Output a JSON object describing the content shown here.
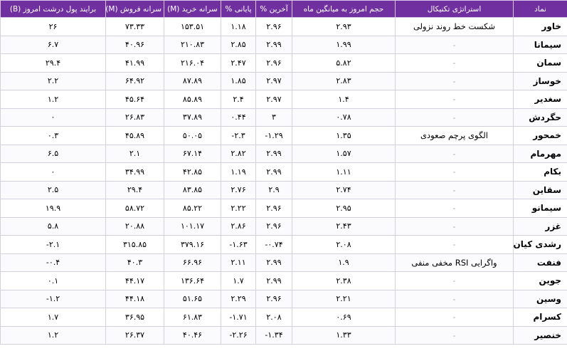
{
  "headers": {
    "symbol": "نماد",
    "strategy": "استراتژی تکنیکال",
    "volume_ratio": "حجم امروز به میانگین ماه",
    "last_pct": "آخرین %",
    "close_pct": "پایانی %",
    "buy_per_capita": "سرانه خرید (M)",
    "sell_per_capita": "سرانه فروش (M)",
    "money_flow": "برایند پول درشت امروز (B)"
  },
  "rows": [
    {
      "symbol": "خاور",
      "strategy": "شکست خط روند نزولی",
      "volume_ratio": "۲.۹۳",
      "last_pct": "۲.۹۶",
      "close_pct": "۱.۱۸",
      "buy_per_capita": "۱۵۳.۵۱",
      "sell_per_capita": "۷۳.۳۳",
      "money_flow": "۲۶"
    },
    {
      "symbol": "سیمانا",
      "strategy": "-",
      "volume_ratio": "۱.۹۹",
      "last_pct": "۲.۹۹",
      "close_pct": "۲.۸۵",
      "buy_per_capita": "۲۱۰.۸۳",
      "sell_per_capita": "۴۰.۹۶",
      "money_flow": "۶.۷"
    },
    {
      "symbol": "سمان",
      "strategy": "-",
      "volume_ratio": "۵.۸۲",
      "last_pct": "۲.۹۶",
      "close_pct": "۲.۴۷",
      "buy_per_capita": "۲۱۶.۰۴",
      "sell_per_capita": "۴۱.۹۹",
      "money_flow": "۲۹.۴"
    },
    {
      "symbol": "خوساز",
      "strategy": "-",
      "volume_ratio": "۲.۸۳",
      "last_pct": "۲.۹۷",
      "close_pct": "۱.۸۵",
      "buy_per_capita": "۸۷.۸۹",
      "sell_per_capita": "۶۴.۹۲",
      "money_flow": "۲.۲"
    },
    {
      "symbol": "سغدیر",
      "strategy": "-",
      "volume_ratio": "۱.۴",
      "last_pct": "۲.۹۷",
      "close_pct": "۲.۴",
      "buy_per_capita": "۸۵.۸۹",
      "sell_per_capita": "۴۵.۶۴",
      "money_flow": "۱.۲"
    },
    {
      "symbol": "حگردش",
      "strategy": "-",
      "volume_ratio": "۰.۷۸",
      "last_pct": "۳",
      "close_pct": "۰.۴۴",
      "buy_per_capita": "۳۷.۸۹",
      "sell_per_capita": "۲۶.۸۳",
      "money_flow": "۰"
    },
    {
      "symbol": "خمحور",
      "strategy": "الگوی پرچم صعودی",
      "volume_ratio": "۱.۳۵",
      "last_pct": "۱.۲۹-",
      "close_pct": "۲.۳-",
      "buy_per_capita": "۵۰.۰۵",
      "sell_per_capita": "۴۵.۸۹",
      "money_flow": "۰.۳"
    },
    {
      "symbol": "مهرمام",
      "strategy": "-",
      "volume_ratio": "۱.۵۷",
      "last_pct": "۲.۹۹",
      "close_pct": "۲.۸۲",
      "buy_per_capita": "۶۷.۱۴",
      "sell_per_capita": "۲.۱",
      "money_flow": "۶.۵"
    },
    {
      "symbol": "بکام",
      "strategy": "-",
      "volume_ratio": "۱.۱۱",
      "last_pct": "۲.۹۹",
      "close_pct": "۱.۱۹",
      "buy_per_capita": "۴۲.۸۵",
      "sell_per_capita": "۳۴.۹۹",
      "money_flow": "۰"
    },
    {
      "symbol": "سقاین",
      "strategy": "-",
      "volume_ratio": "۲.۷۴",
      "last_pct": "۲.۹",
      "close_pct": "۲.۷۶",
      "buy_per_capita": "۸۳.۸۵",
      "sell_per_capita": "۲۹.۴",
      "money_flow": "۲.۵"
    },
    {
      "symbol": "سیمانو",
      "strategy": "-",
      "volume_ratio": "۲.۹۵",
      "last_pct": "۲.۹۶",
      "close_pct": "۲.۲۲",
      "buy_per_capita": "۸۵.۲۲",
      "sell_per_capita": "۵۸.۷۲",
      "money_flow": "۱۹.۹"
    },
    {
      "symbol": "غزر",
      "strategy": "-",
      "volume_ratio": "۲.۴۳",
      "last_pct": "۲.۹۶",
      "close_pct": "۲.۸۶",
      "buy_per_capita": "۱۰۱.۱۷",
      "sell_per_capita": "۲۰.۸۸",
      "money_flow": "۵.۸"
    },
    {
      "symbol": "رشدی کیان",
      "strategy": "-",
      "volume_ratio": "۲.۰۸",
      "last_pct": "۰.۷۴-",
      "close_pct": "۱.۶۳-",
      "buy_per_capita": "۳۷۹.۱۶",
      "sell_per_capita": "۳۱۵.۸۵",
      "money_flow": "۲.۱-"
    },
    {
      "symbol": "فنفت",
      "strategy": "واگرایی RSI مخفی منفی",
      "volume_ratio": "۱.۹",
      "last_pct": "۲.۹۹",
      "close_pct": "۲.۱۱",
      "buy_per_capita": "۶۶.۹۶",
      "sell_per_capita": "۴۰.۳",
      "money_flow": "۰.۴-"
    },
    {
      "symbol": "جوین",
      "strategy": "-",
      "volume_ratio": "۲.۳۸",
      "last_pct": "۲.۹۹",
      "close_pct": "۱.۷",
      "buy_per_capita": "۱۳۶.۶۴",
      "sell_per_capita": "۴۴.۱۷",
      "money_flow": "۰.۱"
    },
    {
      "symbol": "وسین",
      "strategy": "-",
      "volume_ratio": "۲.۲۱",
      "last_pct": "۲.۹۶",
      "close_pct": "۲.۲۹",
      "buy_per_capita": "۵۱.۶۵",
      "sell_per_capita": "۴۴.۱۸",
      "money_flow": "۱.۲-"
    },
    {
      "symbol": "کسرام",
      "strategy": "-",
      "volume_ratio": "۰.۶۹",
      "last_pct": "۲.۰۸",
      "close_pct": "۱.۷۱-",
      "buy_per_capita": "۶۱.۸۳",
      "sell_per_capita": "۳۶.۹۵",
      "money_flow": "۱.۷"
    },
    {
      "symbol": "خنصیر",
      "strategy": "-",
      "volume_ratio": "۱.۳۳",
      "last_pct": "۱.۳۴-",
      "close_pct": "۲.۲۶-",
      "buy_per_capita": "۴۰.۴۶",
      "sell_per_capita": "۲۶.۳۷",
      "money_flow": "۱.۲"
    }
  ]
}
